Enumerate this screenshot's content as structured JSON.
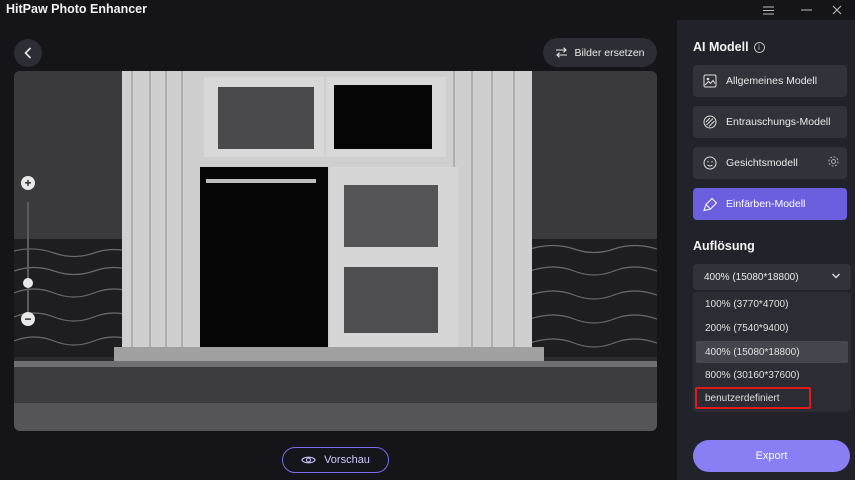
{
  "app": {
    "title": "HitPaw Photo Enhancer",
    "window_controls": [
      "menu-icon",
      "minimize-icon",
      "close-icon"
    ]
  },
  "toolbar": {
    "back_icon": "chevron-left-icon",
    "replace_label": "Bilder ersetzen",
    "replace_icon": "swap-arrows-icon"
  },
  "canvas": {
    "image_subject": "black-and-white photo of an old wooden window on a tiled roof",
    "zoom_in": "+",
    "zoom_out": "−",
    "zoom_level": 0.15
  },
  "preview": {
    "label": "Vorschau",
    "icon": "eye-icon"
  },
  "sidebar": {
    "ai_title": "AI Modell",
    "models": [
      {
        "label": "Allgemeines Modell",
        "icon": "image-icon",
        "active": false
      },
      {
        "label": "Entrauschungs-Modell",
        "icon": "noise-icon",
        "active": false
      },
      {
        "label": "Gesichtsmodell",
        "icon": "face-icon",
        "active": false,
        "settings_icon": "gear-icon"
      },
      {
        "label": "Einfärben-Modell",
        "icon": "paint-brush-icon",
        "active": true
      }
    ],
    "resolution_title": "Auflösung",
    "resolution_selected": "400% (15080*18800)",
    "resolution_options": [
      "100% (3770*4700)",
      "200% (7540*9400)",
      "400% (15080*18800)",
      "800% (30160*37600)",
      "benutzerdefiniert"
    ],
    "export_label": "Export"
  },
  "colors": {
    "background": "#141419",
    "sidebar": "#22222a",
    "accent": "#6b5fe0",
    "export": "#8a7ef5",
    "highlight_border": "#e0191b"
  }
}
